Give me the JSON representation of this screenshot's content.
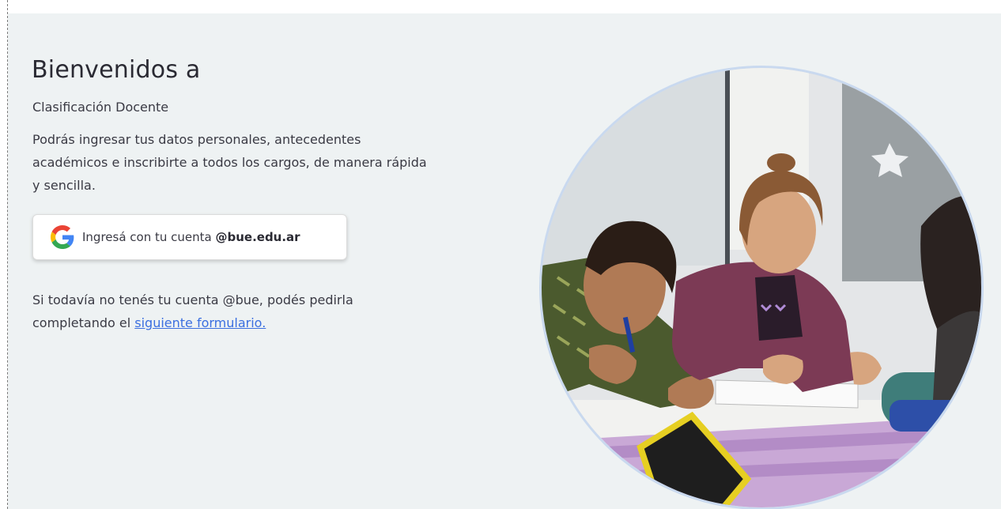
{
  "welcome": {
    "title": "Bienvenidos a",
    "subtitle": "Clasificación Docente",
    "description": "Podrás ingresar tus datos personales, antecedentes académicos e inscribirte a todos los cargos, de manera rápida y sencilla."
  },
  "login_button": {
    "icon": "google-icon",
    "label_prefix": "Ingresá con tu cuenta ",
    "label_domain": "@bue.edu.ar"
  },
  "signup_note": {
    "text_before_link": "Si todavía no tenés tu cuenta @bue, podés pedirla completando el ",
    "link_text": "siguiente formulario."
  },
  "image": {
    "subject": "students-writing-in-classroom-photo"
  },
  "colors": {
    "panel_background": "#eef2f3",
    "link": "#3b6fe0",
    "circle_border": "#c9d9ef"
  }
}
